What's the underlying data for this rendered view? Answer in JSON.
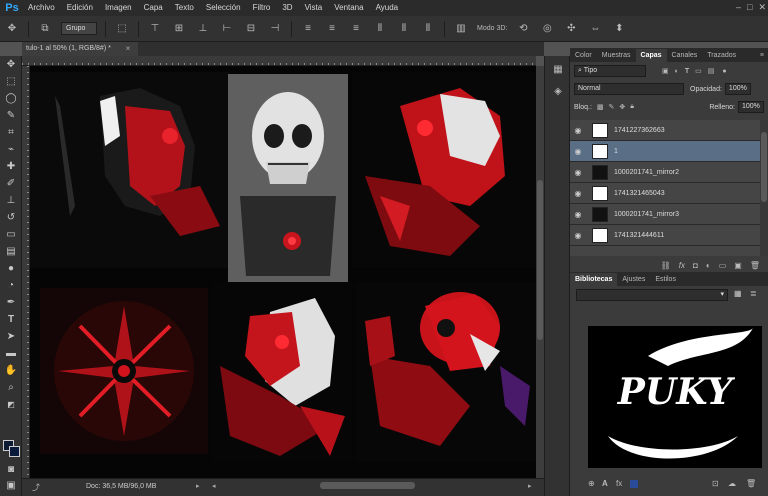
{
  "app": {
    "logo": "Ps"
  },
  "menu": [
    "Archivo",
    "Edición",
    "Imagen",
    "Capa",
    "Texto",
    "Selección",
    "Filtro",
    "3D",
    "Vista",
    "Ventana",
    "Ayuda"
  ],
  "window_controls": [
    "–",
    "□",
    "✕"
  ],
  "options_bar": {
    "auto_select_value": "Grupo",
    "mode3d_label": "Modo 3D:"
  },
  "document": {
    "tab_title": "tulo-1 al 50% (1, RGB/8#) *",
    "tab_close": "×",
    "doc_info": "Doc: 36,5 MB/96,0 MB"
  },
  "panels": {
    "top_tabs": [
      "Color",
      "Muestras",
      "Capas",
      "Canales",
      "Trazados"
    ],
    "active_top_tab": "Capas",
    "filter_kind": "Tipo",
    "blend_mode": "Normal",
    "opacity_label": "Opacidad:",
    "opacity_value": "100%",
    "lock_label": "Bloq.:",
    "fill_label": "Relleno:",
    "fill_value": "100%",
    "layers": [
      {
        "name": "1741227362663",
        "selected": false
      },
      {
        "name": "1",
        "selected": true
      },
      {
        "name": "1000201741_mirror2",
        "selected": false
      },
      {
        "name": "1741321465043",
        "selected": false
      },
      {
        "name": "1000201741_mirror3",
        "selected": false
      },
      {
        "name": "1741321444611",
        "selected": false
      }
    ],
    "bottom_tabs": [
      "Bibliotecas",
      "Ajustes",
      "Estilos"
    ],
    "active_bottom_tab": "Bibliotecas",
    "library_art_text": "PUKY"
  },
  "colors": {
    "accent": "#31a8ff",
    "selected_layer": "#5a6f86",
    "skull_red": "#d0131c"
  }
}
